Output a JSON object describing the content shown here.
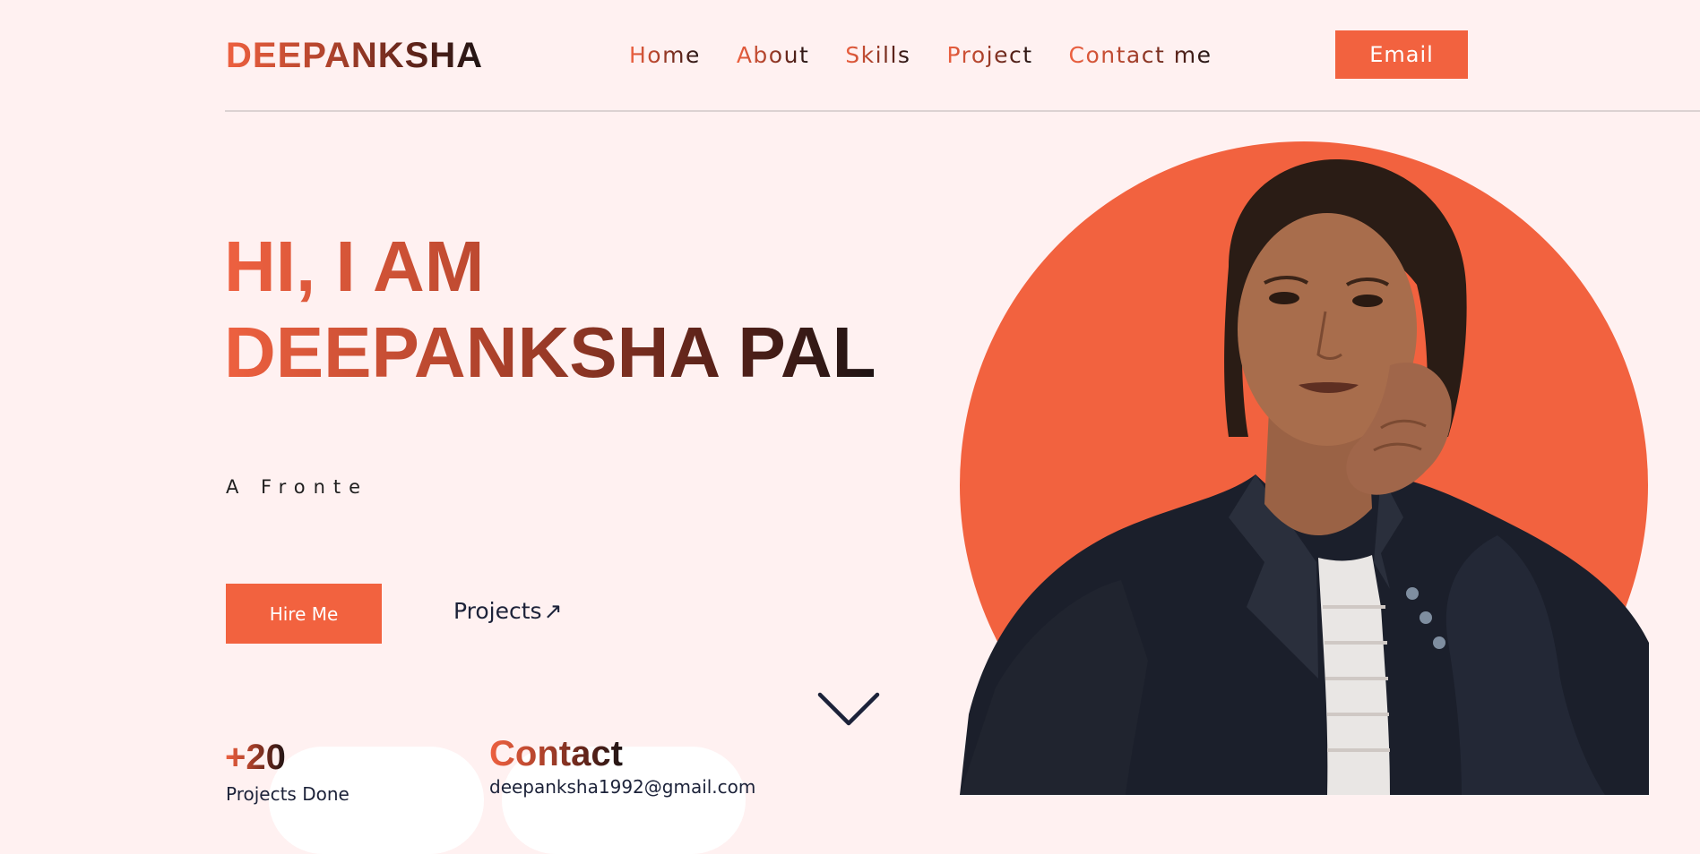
{
  "header": {
    "logo": "DEEPANKSHA",
    "nav": [
      "Home",
      "About",
      "Skills",
      "Project",
      "Contact me"
    ],
    "email_button": "Email"
  },
  "hero": {
    "title_line1": "HI, I AM",
    "title_line2": "DEEPANKSHA PAL",
    "subtitle": "A Fronte",
    "hire_button": "Hire Me",
    "projects_link": "Projects",
    "projects_arrow": "↗"
  },
  "stats": {
    "number": "+20",
    "label": "Projects Done"
  },
  "contact": {
    "heading": "Contact",
    "email": "deepanksha1992@gmail.com"
  },
  "colors": {
    "accent": "#f2623f",
    "background": "#fff1f1",
    "navy": "#1c2239"
  },
  "icons": {
    "scroll": "chevron-down-icon",
    "projects": "arrow-up-right-icon"
  }
}
